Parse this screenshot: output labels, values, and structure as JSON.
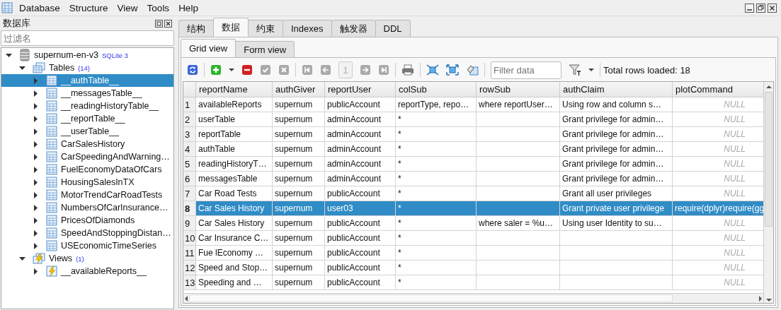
{
  "menu": [
    "Database",
    "Structure",
    "View",
    "Tools",
    "Help"
  ],
  "databases_panel": {
    "title": "数据库",
    "filter_placeholder": "过滤名",
    "tree": [
      {
        "label": "supernum-en-v3",
        "kind": "database",
        "badge": "SQLite 3",
        "expanded": true,
        "selected": false,
        "children": [
          {
            "label": "Tables",
            "kind": "tables",
            "badge": "(14)",
            "expanded": true,
            "selected": false,
            "children": [
              {
                "label": "__authTable__",
                "kind": "table",
                "selected": true
              },
              {
                "label": "__messagesTable__",
                "kind": "table",
                "selected": false
              },
              {
                "label": "__readingHistoryTable__",
                "kind": "table",
                "selected": false
              },
              {
                "label": "__reportTable__",
                "kind": "table",
                "selected": false
              },
              {
                "label": "__userTable__",
                "kind": "table",
                "selected": false
              },
              {
                "label": "CarSalesHistory",
                "kind": "table",
                "selected": false
              },
              {
                "label": "CarSpeedingAndWarning…",
                "kind": "table",
                "selected": false
              },
              {
                "label": "FuelEconomyDataOfCars",
                "kind": "table",
                "selected": false
              },
              {
                "label": "HousingSalesInTX",
                "kind": "table",
                "selected": false
              },
              {
                "label": "MotorTrendCarRoadTests",
                "kind": "table",
                "selected": false
              },
              {
                "label": "NumbersOfCarInsurance…",
                "kind": "table",
                "selected": false
              },
              {
                "label": "PricesOfDiamonds",
                "kind": "table",
                "selected": false
              },
              {
                "label": "SpeedAndStoppingDistan…",
                "kind": "table",
                "selected": false
              },
              {
                "label": "USEconomicTimeSeries",
                "kind": "table",
                "selected": false
              }
            ]
          },
          {
            "label": "Views",
            "kind": "views",
            "badge": "(1)",
            "expanded": true,
            "selected": false,
            "children": [
              {
                "label": "__availableReports__",
                "kind": "view",
                "selected": false
              }
            ]
          }
        ]
      }
    ]
  },
  "tabs": [
    {
      "label": "结构",
      "selected": false
    },
    {
      "label": "数据",
      "selected": true
    },
    {
      "label": "约束",
      "selected": false
    },
    {
      "label": "Indexes",
      "selected": false
    },
    {
      "label": "触发器",
      "selected": false
    },
    {
      "label": "DDL",
      "selected": false
    }
  ],
  "subtabs": [
    {
      "label": "Grid view",
      "selected": true
    },
    {
      "label": "Form view",
      "selected": false
    }
  ],
  "toolbar": {
    "page": "1",
    "filter_placeholder": "Filter data",
    "total": "Total rows loaded: 18"
  },
  "table": {
    "columns": [
      "reportName",
      "authGiver",
      "reportUser",
      "colSub",
      "rowSub",
      "authClaim",
      "plotCommand"
    ],
    "rows": [
      {
        "num": "1",
        "selected": false,
        "cells": [
          "availableReports",
          "supernum",
          "publicAccount",
          "reportType, repo…",
          "where reportUser…",
          "Using row and column s…"
        ],
        "plot": {
          "text": "NULL",
          "is_null": true
        }
      },
      {
        "num": "2",
        "selected": false,
        "cells": [
          "userTable",
          "supernum",
          "adminAccount",
          "*",
          "",
          "Grant privilege for admin…"
        ],
        "plot": {
          "text": "NULL",
          "is_null": true
        }
      },
      {
        "num": "3",
        "selected": false,
        "cells": [
          "reportTable",
          "supernum",
          "adminAccount",
          "*",
          "",
          "Grant privilege for admin…"
        ],
        "plot": {
          "text": "NULL",
          "is_null": true
        }
      },
      {
        "num": "4",
        "selected": false,
        "cells": [
          "authTable",
          "supernum",
          "adminAccount",
          "*",
          "",
          "Grant privilege for admin…"
        ],
        "plot": {
          "text": "NULL",
          "is_null": true
        }
      },
      {
        "num": "5",
        "selected": false,
        "cells": [
          "readingHistoryT…",
          "supernum",
          "adminAccount",
          "*",
          "",
          "Grant privilege for admin…"
        ],
        "plot": {
          "text": "NULL",
          "is_null": true
        }
      },
      {
        "num": "6",
        "selected": false,
        "cells": [
          "messagesTable",
          "supernum",
          "adminAccount",
          "*",
          "",
          "Grant privilege for admin…"
        ],
        "plot": {
          "text": "NULL",
          "is_null": true
        }
      },
      {
        "num": "7",
        "selected": false,
        "cells": [
          "Car Road Tests",
          "supernum",
          "publicAccount",
          "*",
          "",
          "Grant all user privileges"
        ],
        "plot": {
          "text": "NULL",
          "is_null": true
        }
      },
      {
        "num": "8",
        "selected": true,
        "cells": [
          "Car Sales History",
          "supernum",
          "user03",
          "*",
          "",
          "Grant private user privilege"
        ],
        "plot": {
          "text": "require(dplyr)require(gg",
          "is_null": false
        }
      },
      {
        "num": "9",
        "selected": false,
        "cells": [
          "Car Sales History",
          "supernum",
          "publicAccount",
          "*",
          "where  saler = %u…",
          "Using user Identity to su…"
        ],
        "plot": {
          "text": "NULL",
          "is_null": true
        }
      },
      {
        "num": "10",
        "selected": false,
        "cells": [
          "Car Insurance C…",
          "supernum",
          "publicAccount",
          "*",
          "",
          ""
        ],
        "plot": {
          "text": "NULL",
          "is_null": true
        }
      },
      {
        "num": "11",
        "selected": false,
        "cells": [
          "Fue lEconomy …",
          "supernum",
          "publicAccount",
          "*",
          "",
          ""
        ],
        "plot": {
          "text": "NULL",
          "is_null": true
        }
      },
      {
        "num": "12",
        "selected": false,
        "cells": [
          "Speed and Stop…",
          "supernum",
          "publicAccount",
          "*",
          "",
          ""
        ],
        "plot": {
          "text": "NULL",
          "is_null": true
        }
      },
      {
        "num": "13",
        "selected": false,
        "cells": [
          "Speeding and …",
          "supernum",
          "publicAccount",
          "*",
          "",
          ""
        ],
        "plot": {
          "text": "NULL",
          "is_null": true
        }
      }
    ]
  }
}
